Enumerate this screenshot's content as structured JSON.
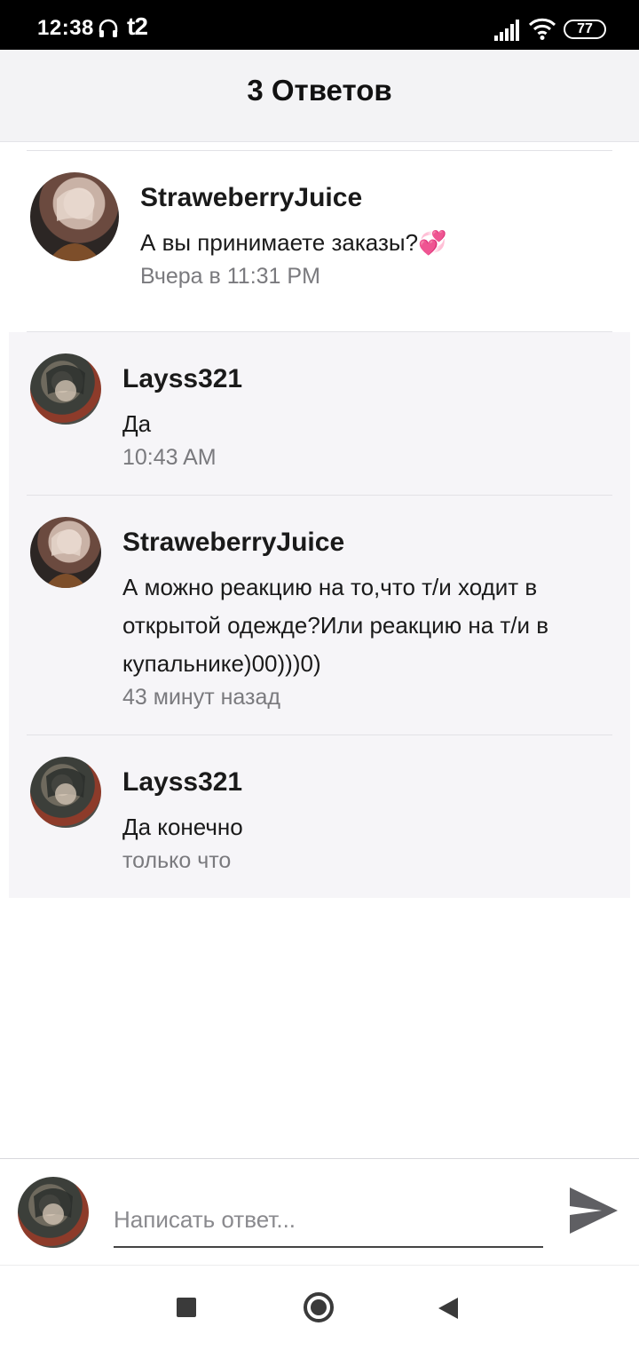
{
  "status_bar": {
    "time": "12:38",
    "carrier": "t2",
    "battery": "77",
    "icons": [
      "headphones-icon",
      "signal-icon",
      "wifi-icon",
      "battery-icon"
    ]
  },
  "header": {
    "title": "3 Ответов"
  },
  "parent_comment": {
    "author": "StraweberryJuice",
    "text": "А вы принимаете заказы?💞",
    "time": "Вчера в 11:31 PM",
    "avatar": "avatar-strawberryjuice"
  },
  "replies": [
    {
      "author": "Layss321",
      "text": "Да",
      "time": "10:43 AM",
      "avatar": "avatar-layss321"
    },
    {
      "author": "StraweberryJuice",
      "text_lines": [
        "А можно реакцию на то,что т/и ходит в",
        "открытой одежде?Или реакцию на т/и в",
        "купальнике)00)))0)"
      ],
      "time": "43 минут назад",
      "avatar": "avatar-strawberryjuice"
    },
    {
      "author": "Layss321",
      "text": "Да конечно",
      "time": "только что",
      "avatar": "avatar-layss321"
    }
  ],
  "compose": {
    "placeholder": "Написать ответ...",
    "value": "",
    "send_icon": "send-icon"
  },
  "navbar": {
    "icons": [
      "recents-icon",
      "home-icon",
      "back-icon"
    ]
  },
  "colors": {
    "header_bg": "#f3f3f5",
    "reply_block_bg": "#f6f5f8",
    "muted_text": "#7a7a7e"
  }
}
